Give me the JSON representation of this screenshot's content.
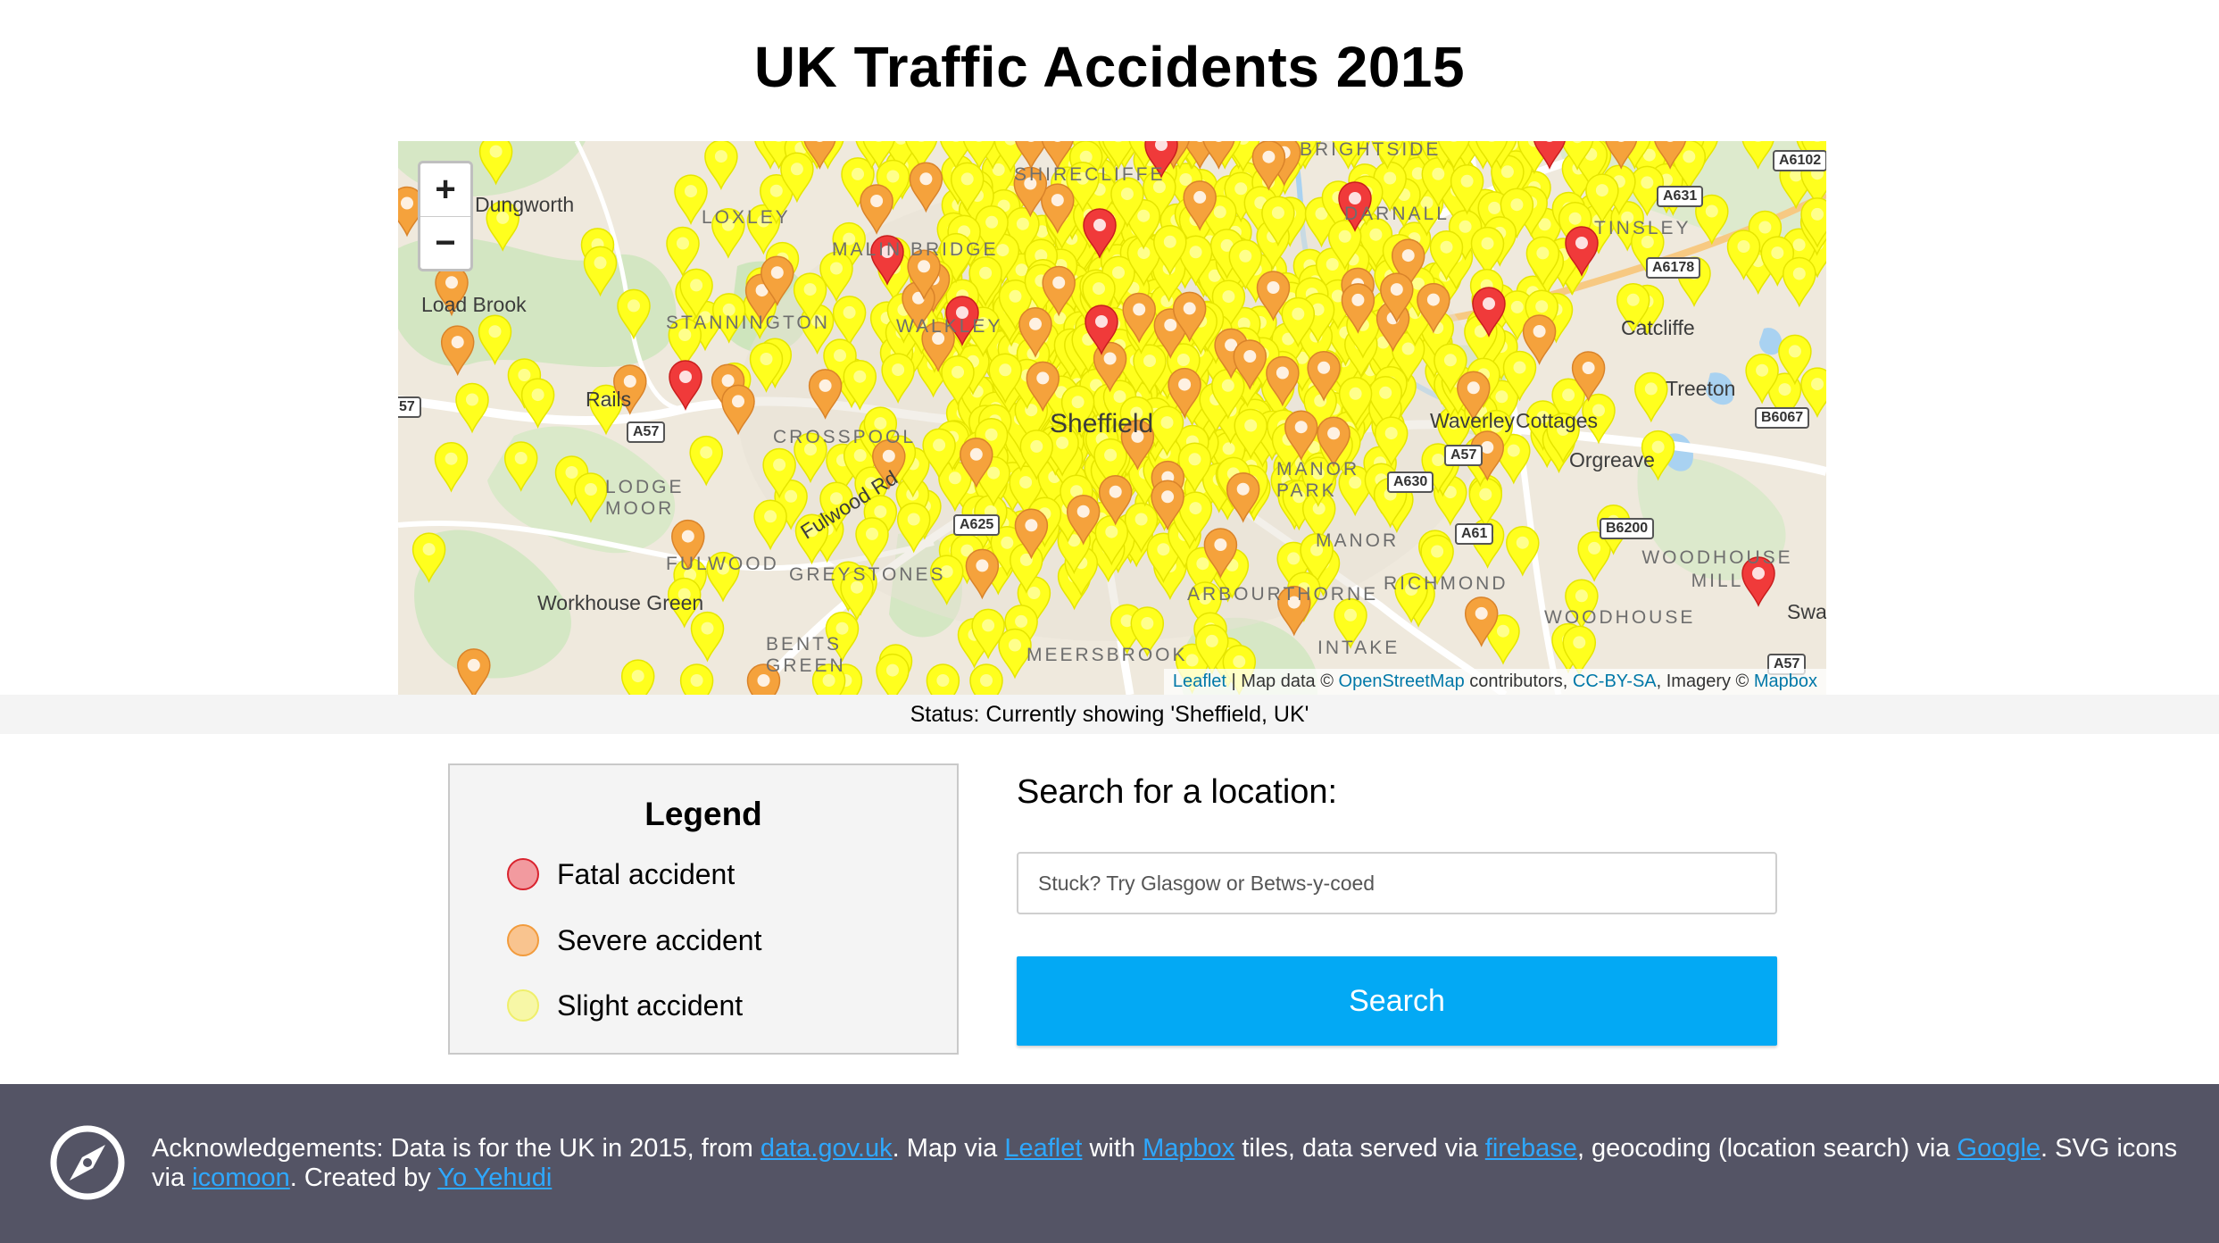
{
  "page": {
    "title": "UK Traffic Accidents 2015"
  },
  "map": {
    "zoom_in": "+",
    "zoom_out": "−",
    "labels": {
      "dungworth": "Dungworth",
      "loxley": "LOXLEY",
      "shirecliffe": "SHIRECLIFFE",
      "brightside": "BRIGHTSIDE",
      "load_brook": "Load Brook",
      "stannington": "STANNINGTON",
      "walkley": "WALKLEY",
      "malin_bridge": "MALIN BRIDGE",
      "darnall": "DARNALL",
      "catcliffe": "Catcliffe",
      "treeton": "Treeton",
      "rails": "Rails",
      "crosspool": "CROSSPOOL",
      "lodge_moor": "LODGE MOOR",
      "waverley": "Waverley",
      "cottages": "Cottages",
      "orgreave": "Orgreave",
      "manor_park": "MANOR PARK",
      "fulwood_rd": "Fulwood Rd",
      "fulwood": "FULWOOD",
      "greystones": "GREYSTONES",
      "manor": "MANOR",
      "richmond": "RICHMOND",
      "woodhouse_mill": "WOODHOUSE MILL",
      "woodhouse": "WOODHOUSE",
      "workhouse_green": "Workhouse Green",
      "bents_green": "BENTS GREEN",
      "meersbrook": "MEERSBROOK",
      "intake": "INTAKE",
      "arbourthorne": "ARBOURTHORNE",
      "sheffield": "Sheffield",
      "swallownest": "Swa",
      "tinsley": "TINSLEY"
    },
    "roads": {
      "a57_west": "A57",
      "a57_edge": "57",
      "a625": "A625",
      "a631": "A631",
      "a6102": "A6102",
      "a630": "A630",
      "a57_east": "A57",
      "b6200": "B6200",
      "b6067": "B6067",
      "a57_se": "A57",
      "a61": "A61",
      "a6178": "A6178"
    },
    "attribution": {
      "leaflet": "Leaflet",
      "sep1": " | Map data © ",
      "osm": "OpenStreetMap",
      "sep2": " contributors, ",
      "ccbysa": "CC-BY-SA",
      "sep3": ", Imagery © ",
      "mapbox": "Mapbox"
    },
    "marker_colors": {
      "fatal": "#f03a3a",
      "severe": "#f5a23c",
      "slight": "#ffff1e"
    }
  },
  "status": {
    "text": "Status: Currently showing 'Sheffield, UK'"
  },
  "legend": {
    "title": "Legend",
    "items": [
      {
        "label": "Fatal accident",
        "fill": "#f29a9f",
        "stroke": "#d9232e"
      },
      {
        "label": "Severe accident",
        "fill": "#f9c48f",
        "stroke": "#f29b3c"
      },
      {
        "label": "Slight accident",
        "fill": "#f7f7a6",
        "stroke": "#efef6a"
      }
    ]
  },
  "search": {
    "heading": "Search for a location:",
    "placeholder": "Stuck? Try Glasgow or Betws-y-coed",
    "value": "",
    "button": "Search"
  },
  "footer": {
    "t1": "Acknowledgements: Data is for the UK in 2015, from ",
    "l1": "data.gov.uk",
    "t2": ". Map via ",
    "l2": "Leaflet",
    "t3": " with ",
    "l3": "Mapbox",
    "t4": " tiles, data served via ",
    "l4": "firebase",
    "t5": ", geocoding (location search) via ",
    "l5": "Google",
    "t6": ". SVG icons via ",
    "l6": "icomoon",
    "t7": ". Created by ",
    "l7": "Yo Yehudi"
  }
}
